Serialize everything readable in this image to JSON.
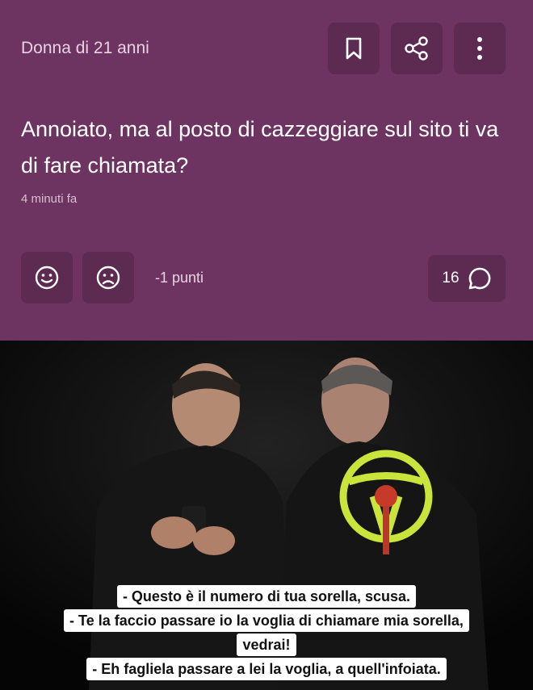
{
  "post": {
    "author": "Donna di 21 anni",
    "question": "Annoiato, ma al posto di cazzeggiare sul sito ti va di fare chiamata?",
    "time": "4 minuti fa",
    "points": "-1 punti",
    "comment_count": "16",
    "icons": {
      "bookmark": "bookmark-icon",
      "share": "share-icon",
      "more": "more-vertical-icon",
      "happy": "smile-icon",
      "sad": "frown-icon",
      "comment": "comment-bubble-icon"
    },
    "colors": {
      "card": "#6e3461",
      "button": "#5d2a52"
    }
  },
  "meme": {
    "subtitles": [
      "- Questo è il numero di tua sorella, scusa.",
      "- Te la faccio passare io la voglia di chiamare mia sorella,",
      "vedrai!",
      "- Eh fagliela passare a lei la voglia, a quell'infoiata."
    ]
  }
}
